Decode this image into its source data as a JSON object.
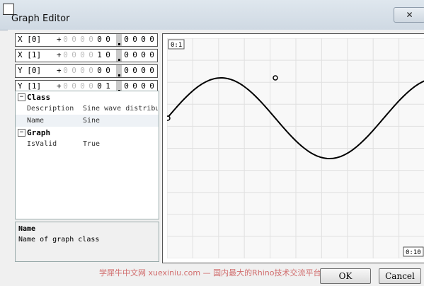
{
  "window": {
    "title": "Graph Editor",
    "close_glyph": "✕"
  },
  "params": [
    {
      "label": "X [0]",
      "sign": "+",
      "digits": [
        "0",
        "0",
        "0",
        "0",
        "0",
        "0"
      ],
      "frac": [
        "0",
        "0",
        "0",
        "0"
      ]
    },
    {
      "label": "X [1]",
      "sign": "+",
      "digits": [
        "0",
        "0",
        "0",
        "0",
        "1",
        "0"
      ],
      "frac": [
        "0",
        "0",
        "0",
        "0"
      ]
    },
    {
      "label": "Y [0]",
      "sign": "+",
      "digits": [
        "0",
        "0",
        "0",
        "0",
        "0",
        "0"
      ],
      "frac": [
        "0",
        "0",
        "0",
        "0"
      ]
    },
    {
      "label": "Y [1]",
      "sign": "+",
      "digits": [
        "0",
        "0",
        "0",
        "0",
        "0",
        "1"
      ],
      "frac": [
        "0",
        "0",
        "0",
        "0"
      ]
    }
  ],
  "properties": {
    "categories": [
      {
        "toggle": "−",
        "label": "Class",
        "items": [
          {
            "name": "Description",
            "value": "Sine wave distribu"
          },
          {
            "name": "Name",
            "value": "Sine"
          }
        ]
      },
      {
        "toggle": "−",
        "label": "Graph",
        "items": [
          {
            "name": "IsValid",
            "value": "True"
          }
        ]
      }
    ]
  },
  "description": {
    "title": "Name",
    "text": "Name of graph class"
  },
  "graph": {
    "top_left_label": "0:1",
    "bottom_right_label": "0:10",
    "curve": "sine"
  },
  "buttons": {
    "ok": "OK",
    "cancel": "Cancel"
  },
  "watermark": "学犀牛中文网 xuexiniu.com  — 国内最大的Rhino技术交流平台"
}
